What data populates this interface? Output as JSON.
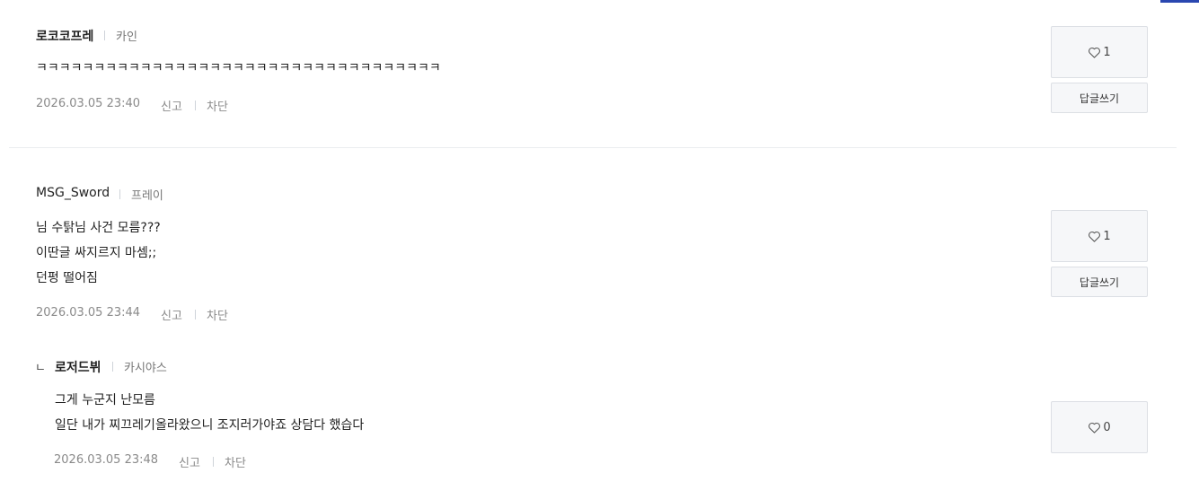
{
  "comments": [
    {
      "author": "로코코프레",
      "game": "카인",
      "lines": [
        "ㅋㅋㅋㅋㅋㅋㅋㅋㅋㅋㅋㅋㅋㅋㅋㅋㅋㅋㅋㅋㅋㅋㅋㅋㅋㅋㅋㅋㅋㅋㅋㅋㅋㅋㅋ"
      ],
      "date": "2026.03.05 23:40",
      "report_label": "신고",
      "block_label": "차단",
      "likes": "1",
      "reply_label": "답글쓰기"
    },
    {
      "author": "MSG_Sword",
      "game": "프레이",
      "lines": [
        "님 수탉님 사건 모름???",
        "이딴글 싸지르지 마셈;;",
        "던펑 떨어짐"
      ],
      "date": "2026.03.05 23:44",
      "report_label": "신고",
      "block_label": "차단",
      "likes": "1",
      "reply_label": "답글쓰기"
    }
  ],
  "reply": {
    "marker": "ㄴ",
    "author": "로저드뷔",
    "game": "카시야스",
    "lines": [
      "그게 누군지 난모름",
      "일단 내가 찌끄레기올라왔으니 조지러가야죠 상담다 했습다"
    ],
    "date": "2026.03.05 23:48",
    "report_label": "신고",
    "block_label": "차단",
    "likes": "0"
  },
  "icons": {
    "like": "heart-icon"
  },
  "colors": {
    "accent": "#2a47b0"
  }
}
